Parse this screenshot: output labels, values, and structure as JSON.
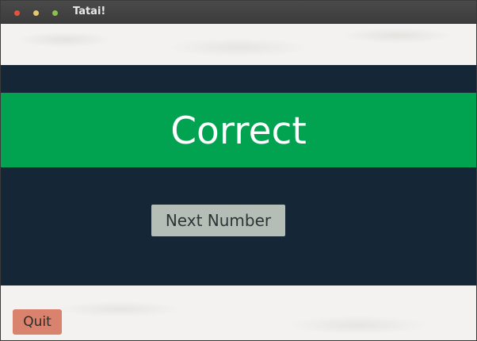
{
  "window": {
    "title": "Tatai!",
    "controls": [
      {
        "name": "close",
        "color": "#e5533b"
      },
      {
        "name": "minimize",
        "color": "#e8c66a"
      },
      {
        "name": "maximize",
        "color": "#8bc34a"
      }
    ]
  },
  "result": {
    "text": "Correct",
    "band_color": "#01a351",
    "panel_color": "#152736"
  },
  "actions": {
    "next_label": "Next Number",
    "quit_label": "Quit",
    "quit_color": "#d9826e"
  }
}
